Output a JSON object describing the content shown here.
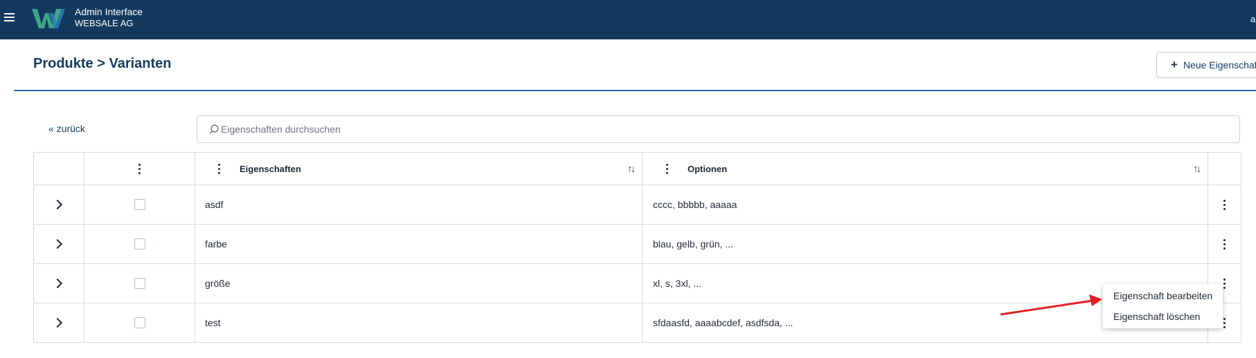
{
  "header": {
    "app_title": "Admin Interface",
    "company": "WEBSALE AG",
    "user_initial": "a",
    "brand_color": "#133a5e",
    "logo_icon": "websale-w-logo"
  },
  "page": {
    "title": "Produkte > Varianten",
    "new_button_label": "Neue Eigenschaft"
  },
  "toolbar": {
    "back_label": "« zurück",
    "search_placeholder": "Eigenschaften durchsuchen"
  },
  "table": {
    "columns": [
      "Eigenschaften",
      "Optionen"
    ],
    "rows": [
      {
        "name": "asdf",
        "options": "cccc, bbbbb, aaaaa"
      },
      {
        "name": "farbe",
        "options": "blau, gelb, grün, ..."
      },
      {
        "name": "größe",
        "options": "xl, s, 3xl, ..."
      },
      {
        "name": "test",
        "options": "sfdaasfd, aaaabcdef, asdfsda, ..."
      }
    ]
  },
  "context_menu": {
    "items": [
      "Eigenschaft bearbeiten",
      "Eigenschaft löschen"
    ],
    "arrow_color": "#e02020"
  }
}
